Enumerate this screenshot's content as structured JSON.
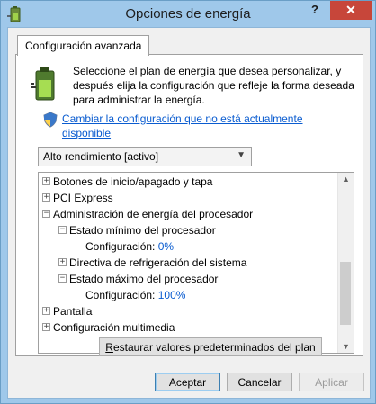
{
  "window": {
    "title": "Opciones de energía",
    "help_label": "?",
    "close_label": "✕"
  },
  "tab": {
    "label": "Configuración avanzada"
  },
  "description": "Seleccione el plan de energía que desea personalizar, y después elija la configuración que refleje la forma deseada para administrar la energía.",
  "link_text": "Cambiar la configuración que no está actualmente disponible",
  "plan_select": {
    "value": "Alto rendimiento [activo]"
  },
  "tree": {
    "items": [
      {
        "label": "Botones de inicio/apagado y tapa",
        "expander": "+"
      },
      {
        "label": "PCI Express",
        "expander": "+"
      },
      {
        "label": "Administración de energía del procesador",
        "expander": "−"
      },
      {
        "label": "Estado mínimo del procesador",
        "expander": "−"
      },
      {
        "label": "Configuración:",
        "value": "0%"
      },
      {
        "label": "Directiva de refrigeración del sistema",
        "expander": "+"
      },
      {
        "label": "Estado máximo del procesador",
        "expander": "−"
      },
      {
        "label": "Configuración:",
        "value": "100%"
      },
      {
        "label": "Pantalla",
        "expander": "+"
      },
      {
        "label": "Configuración multimedia",
        "expander": "+"
      }
    ]
  },
  "buttons": {
    "restore_prefix": "R",
    "restore_rest": "estaurar valores predeterminados del plan",
    "ok": "Aceptar",
    "cancel": "Cancelar",
    "apply": "Aplicar"
  }
}
